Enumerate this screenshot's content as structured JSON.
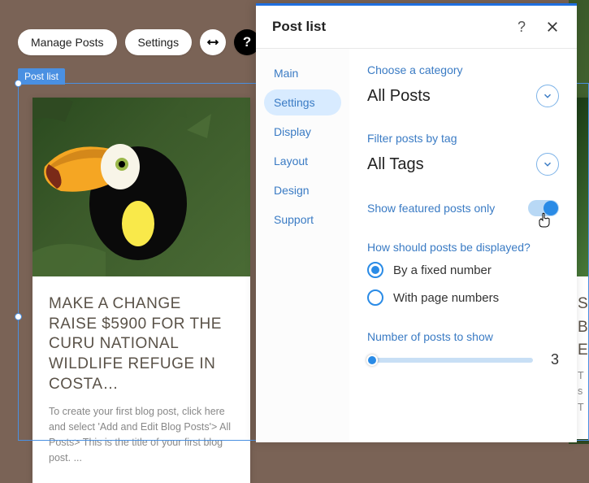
{
  "toolbar": {
    "manage_posts": "Manage Posts",
    "settings": "Settings"
  },
  "selection_label": "Post list",
  "card": {
    "title": "MAKE A CHANGE RAISE $5900 FOR THE CURU NATIONAL WILDLIFE REFUGE IN COSTA…",
    "text": "To create your first blog post, click here and select 'Add and Edit Blog Posts'> All Posts> This is the title of your first blog post. ..."
  },
  "card2": {
    "t1": "S",
    "t2": "B",
    "t3": "E",
    "x1": "T",
    "x2": "s",
    "x3": "T"
  },
  "panel": {
    "title": "Post list",
    "nav": {
      "items": [
        {
          "label": "Main"
        },
        {
          "label": "Settings"
        },
        {
          "label": "Display"
        },
        {
          "label": "Layout"
        },
        {
          "label": "Design"
        },
        {
          "label": "Support"
        }
      ],
      "active_index": 1
    },
    "category": {
      "label": "Choose a category",
      "value": "All Posts"
    },
    "tag": {
      "label": "Filter posts by tag",
      "value": "All Tags"
    },
    "featured": {
      "label": "Show featured posts only",
      "enabled": true
    },
    "display_mode": {
      "label": "How should posts be displayed?",
      "options": [
        {
          "label": "By a fixed number",
          "checked": true
        },
        {
          "label": "With page numbers",
          "checked": false
        }
      ]
    },
    "post_count": {
      "label": "Number of posts to show",
      "value": "3"
    }
  },
  "colors": {
    "accent": "#2a8be6",
    "link": "#3a7bc4"
  }
}
